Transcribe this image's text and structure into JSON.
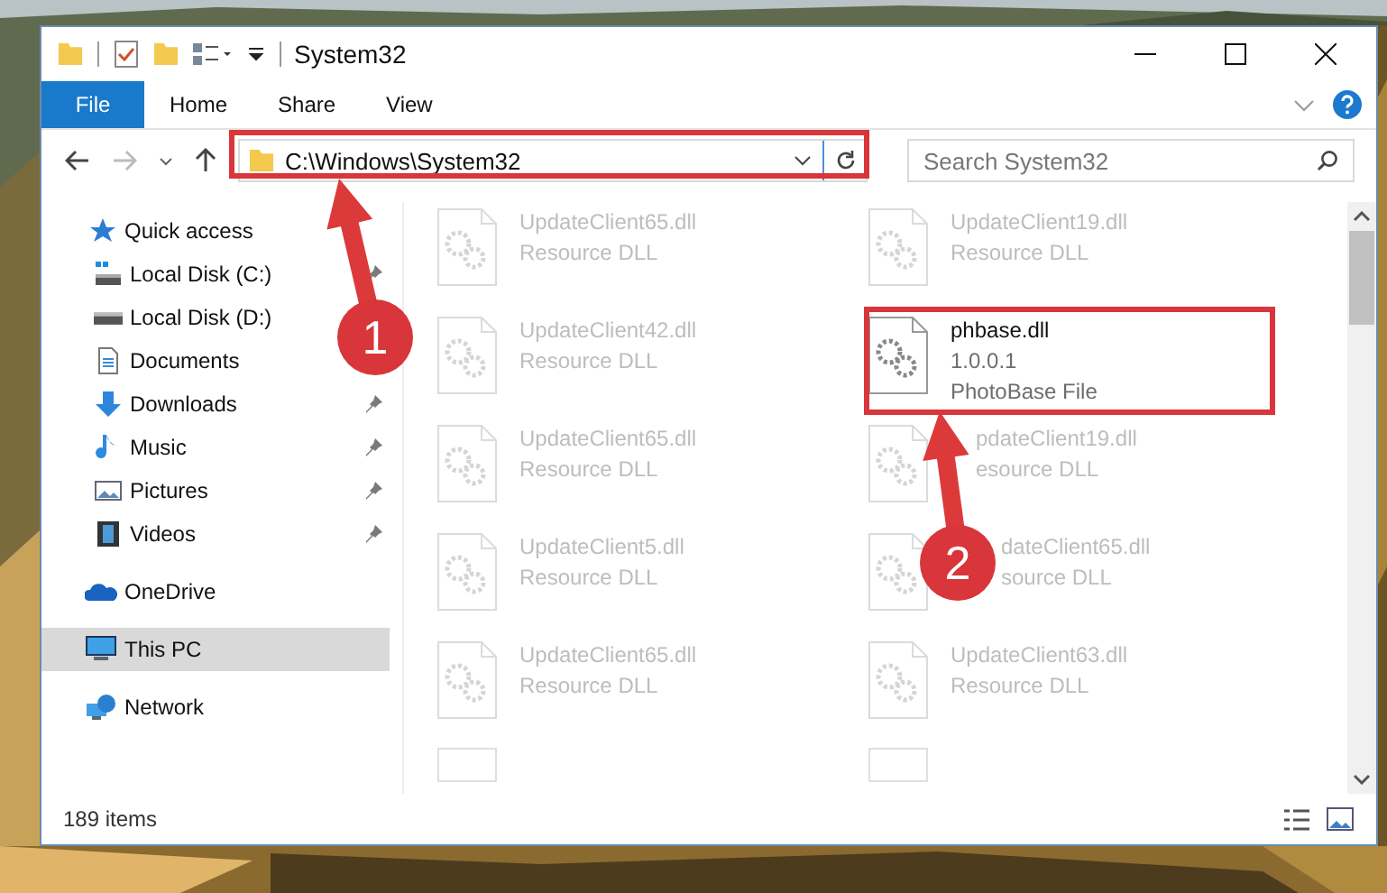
{
  "window": {
    "title": "System32"
  },
  "ribbon_tabs": [
    {
      "label": "File",
      "selected": true
    },
    {
      "label": "Home",
      "selected": false
    },
    {
      "label": "Share",
      "selected": false
    },
    {
      "label": "View",
      "selected": false
    }
  ],
  "address_bar": {
    "path": "C:\\Windows\\System32"
  },
  "search": {
    "placeholder": "Search System32"
  },
  "sidebar": {
    "items": [
      {
        "label": "Quick access",
        "kind": "star",
        "selected": false,
        "children": [
          {
            "label": "Local Disk (C:)",
            "kind": "system-drive",
            "pinned": true
          },
          {
            "label": "Local Disk (D:)",
            "kind": "drive"
          },
          {
            "label": "Documents",
            "kind": "documents"
          },
          {
            "label": "Downloads",
            "kind": "downloads",
            "pinned": true
          },
          {
            "label": "Music",
            "kind": "music",
            "pinned": true
          },
          {
            "label": "Pictures",
            "kind": "pictures",
            "pinned": true
          },
          {
            "label": "Videos",
            "kind": "videos",
            "pinned": true
          }
        ]
      },
      {
        "label": "OneDrive",
        "kind": "cloud",
        "selected": false
      },
      {
        "label": "This PC",
        "kind": "computer",
        "selected": true
      },
      {
        "label": "Network",
        "kind": "network",
        "selected": false
      }
    ]
  },
  "files": [
    {
      "name": "UpdateClient65.dll",
      "lines": [
        "Resource DLL"
      ],
      "faded": true
    },
    {
      "name": "UpdateClient19.dll",
      "lines": [
        "Resource DLL"
      ],
      "faded": true
    },
    {
      "name": "UpdateClient42.dll",
      "lines": [
        "Resource DLL"
      ],
      "faded": true
    },
    {
      "name": "phbase.dll",
      "lines": [
        "1.0.0.1",
        "PhotoBase File"
      ],
      "faded": false
    },
    {
      "name": "UpdateClient65.dll",
      "lines": [
        "Resource DLL"
      ],
      "faded": true
    },
    {
      "name": "pdateClient19.dll",
      "lines": [
        "esource DLL"
      ],
      "faded": true
    },
    {
      "name": "UpdateClient5.dll",
      "lines": [
        "Resource DLL"
      ],
      "faded": true
    },
    {
      "name": "dateClient65.dll",
      "lines": [
        "source DLL"
      ],
      "faded": true
    },
    {
      "name": "UpdateClient65.dll",
      "lines": [
        "Resource DLL"
      ],
      "faded": true
    },
    {
      "name": "UpdateClient63.dll",
      "lines": [
        "Resource DLL"
      ],
      "faded": true
    }
  ],
  "status_bar": {
    "item_count": "189 items"
  },
  "annotations": [
    {
      "label": "1"
    },
    {
      "label": "2"
    }
  ]
}
